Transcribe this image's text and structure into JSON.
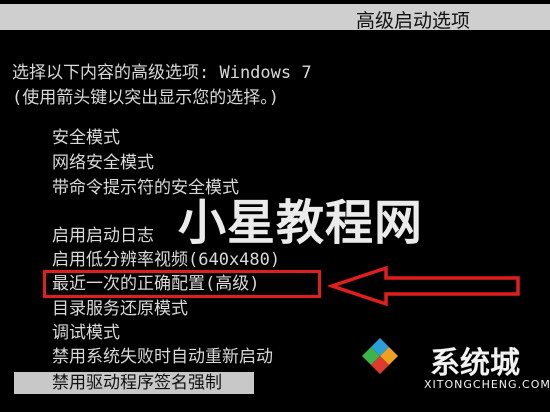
{
  "header": {
    "title": "高级启动选项"
  },
  "prompt": {
    "line1": "选择以下内容的高级选项: Windows 7",
    "line2": "(使用箭头键以突出显示您的选择。)"
  },
  "menu": {
    "items": [
      {
        "label": "安全模式"
      },
      {
        "label": "网络安全模式"
      },
      {
        "label": "带命令提示符的安全模式"
      },
      {
        "label": "启用启动日志"
      },
      {
        "label": "启用低分辨率视频(640x480)"
      },
      {
        "label": "最近一次的正确配置(高级)"
      },
      {
        "label": "目录服务还原模式"
      },
      {
        "label": "调试模式"
      },
      {
        "label": "禁用系统失败时自动重新启动"
      },
      {
        "label": "禁用驱动程序签名强制"
      }
    ],
    "selected_label": "禁用驱动程序签名强制",
    "highlighted_label": "最近一次的正确配置(高级)"
  },
  "annotation": {
    "color": "#e01e1e"
  },
  "watermark": {
    "text": "小星教程网"
  },
  "logo": {
    "name_cn": "系统城",
    "name_en": "XITONGCHENG.COM",
    "colors": [
      "#2a9fd8",
      "#f0a020",
      "#3bb54a",
      "#e03a2f"
    ]
  }
}
